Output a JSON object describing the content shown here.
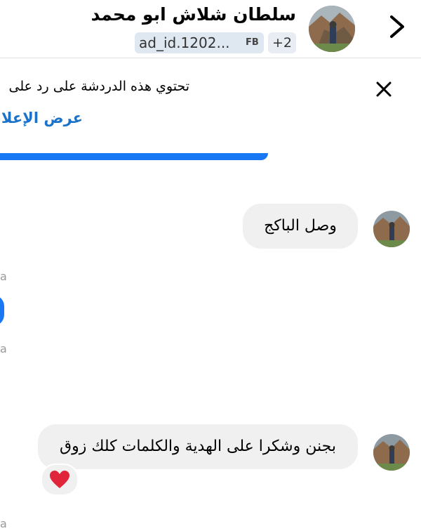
{
  "header": {
    "title": "سلطان شلاش ابو محمد",
    "ad_id": "ad_id.1202...",
    "fb_tag": "FB",
    "extra_count": "+2",
    "back_icon": "chevron-right-icon"
  },
  "banner": {
    "text": "تحتوي هذه الدردشة على رد على",
    "link": "عرض الإعلا",
    "close_icon": "close-icon",
    "accent": "#1877f2"
  },
  "messages": [
    {
      "text": "وصل الباكج"
    },
    {
      "text": "بجنن وشكرا على الهدية والكلمات كلك زوق",
      "reaction": "❤️"
    }
  ],
  "edge_labels": [
    "a",
    "a",
    "a"
  ]
}
